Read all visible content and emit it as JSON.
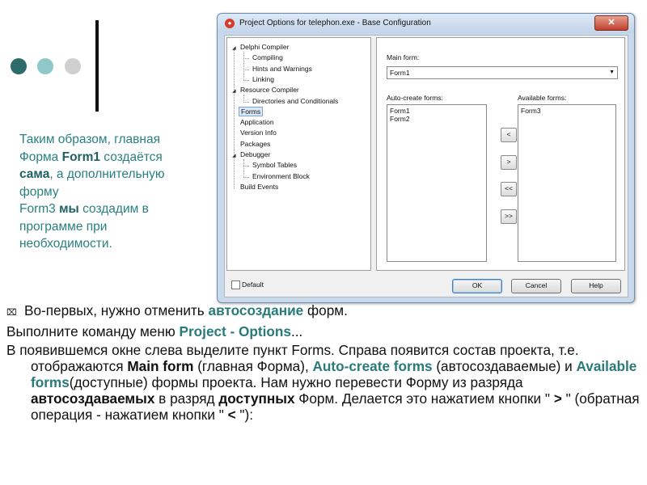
{
  "dialog": {
    "title": "Project Options for telephon.exe - Base Configuration",
    "close_label": "✕",
    "tree": [
      {
        "label": "Delphi Compiler",
        "level": 0,
        "expanded": true
      },
      {
        "label": "Compiling",
        "level": 1
      },
      {
        "label": "Hints and Warnings",
        "level": 1
      },
      {
        "label": "Linking",
        "level": 1
      },
      {
        "label": "Resource Compiler",
        "level": 0,
        "expanded": true
      },
      {
        "label": "Directories and Conditionals",
        "level": 1
      },
      {
        "label": "Forms",
        "level": 0,
        "selected": true
      },
      {
        "label": "Application",
        "level": 0
      },
      {
        "label": "Version Info",
        "level": 0
      },
      {
        "label": "Packages",
        "level": 0
      },
      {
        "label": "Debugger",
        "level": 0,
        "expanded": true
      },
      {
        "label": "Symbol Tables",
        "level": 1
      },
      {
        "label": "Environment Block",
        "level": 1
      },
      {
        "label": "Build Events",
        "level": 0
      }
    ],
    "main_form_label": "Main form:",
    "main_form_value": "Form1",
    "auto_create_label": "Auto-create forms:",
    "auto_create_items": [
      "Form1",
      "Form2"
    ],
    "available_label": "Available forms:",
    "available_items": [
      "Form3"
    ],
    "move_buttons": {
      "left": "<",
      "right": ">",
      "all_left": "<<",
      "all_right": ">>"
    },
    "default_label": "Default",
    "ok_label": "OK",
    "cancel_label": "Cancel",
    "help_label": "Help"
  },
  "side_note": {
    "l1": "Таким образом, главная",
    "l2a": "Форма ",
    "l2b": "Form1",
    "l2c": " создаётся",
    "l3a": "сама",
    "l3b": ", а дополнительную",
    "l4": "форму",
    "l5a": "Form3 ",
    "l5b": "мы",
    "l5c": " создадим в",
    "l6": "программе при",
    "l7": "необходимости."
  },
  "body": {
    "bullet_icon": "⌧",
    "p1a": "Во-первых, нужно отменить ",
    "p1b": "автосоздание",
    "p1c": " форм.",
    "p2a": "Выполните команду меню ",
    "p2b": "Project - Options",
    "p2c": "...",
    "p3a": "В появившемся окне слева выделите пункт Forms. Справа появится состав проекта, т.е. отображаются ",
    "p3b": "Main form",
    "p3c": " (главная Форма), ",
    "p3d": "Auto-create forms",
    "p3e": " (автосоздаваемые) и ",
    "p3f": "Available forms",
    "p3g": "(доступные) формы проекта. Нам нужно перевести Форму из разряда ",
    "p3h": "автосоздаваемых",
    "p3i": " в разряд ",
    "p3j": "доступных",
    "p3k": " Форм. Делается это нажатием кнопки \" ",
    "p3l": ">",
    "p3m": " \" (обратная операция - нажатием кнопки \" ",
    "p3n": "<",
    "p3o": " \"):"
  },
  "colors": {
    "accent": "#2a8080",
    "dot1": "#2e6b6b",
    "dot2": "#8ec8c8",
    "dot3": "#cfcfcf"
  }
}
